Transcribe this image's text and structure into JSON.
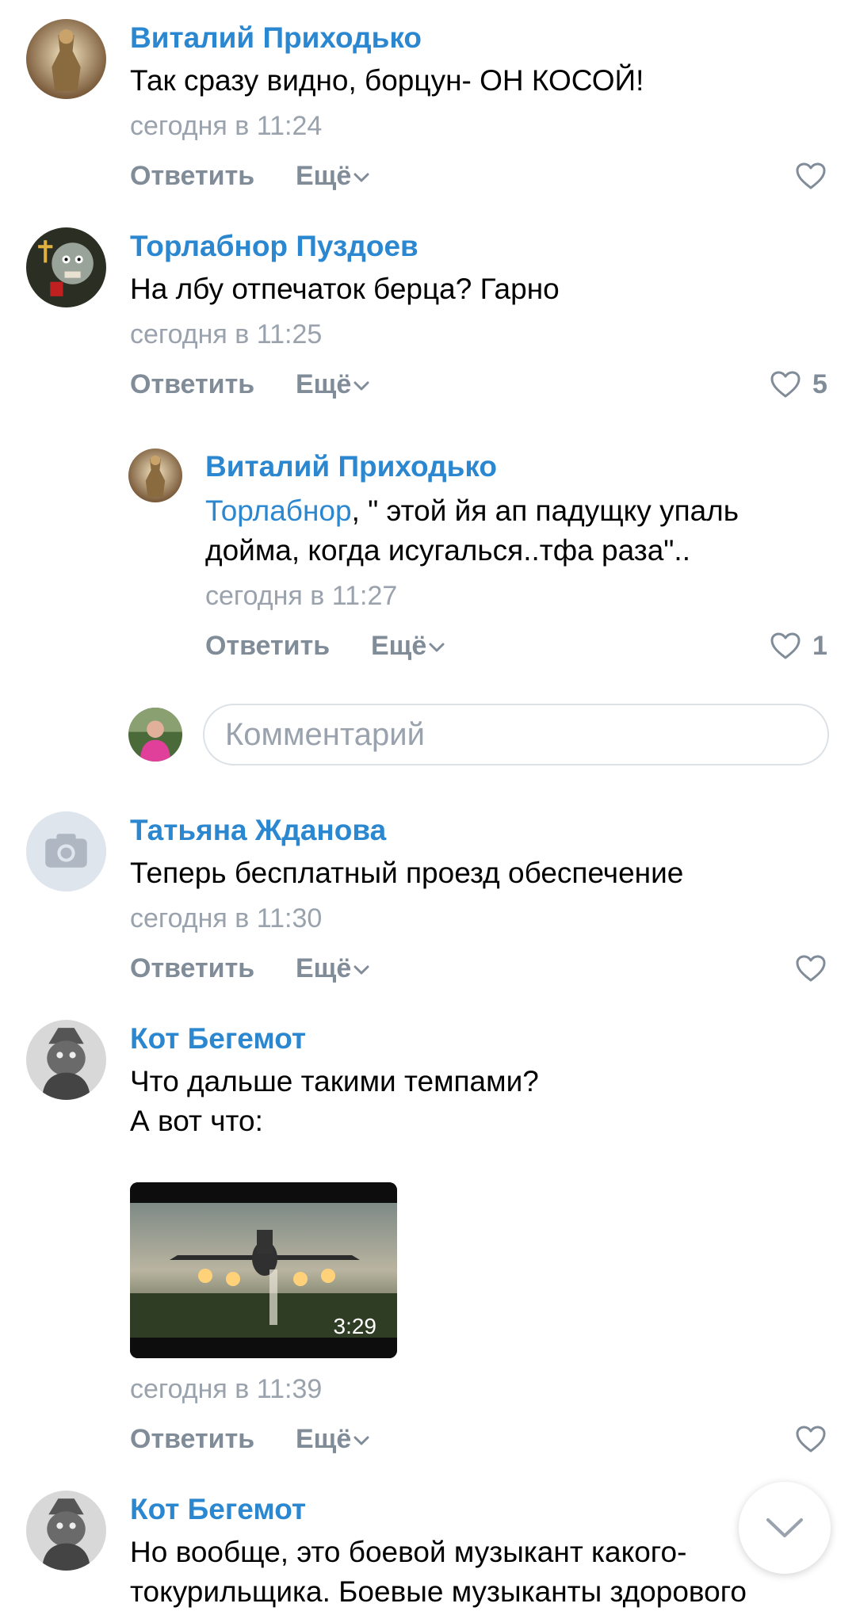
{
  "colors": {
    "author": "#2a87d0",
    "meta": "#99a2ad",
    "action": "#818c99",
    "like_icon": "#818c99"
  },
  "icons": {
    "like": "heart-outline-icon",
    "more": "chevron-down-icon",
    "scroll": "chevron-down-icon",
    "no_avatar": "camera-icon"
  },
  "comments": [
    {
      "author": "Виталий Приходько",
      "lines": [
        "Так сразу видно, борцун- ОН КОСОЙ!"
      ],
      "time": "сегодня в 11:24",
      "reply": "Ответить",
      "more": "Ещё",
      "likes": ""
    },
    {
      "author": "Торлабнор Пуздоев",
      "lines": [
        "На лбу отпечаток берца? Гарно"
      ],
      "time": "сегодня в 11:25",
      "reply": "Ответить",
      "more": "Ещё",
      "likes": "5"
    },
    {
      "author": "Виталий Приходько",
      "mention": "Торлабнор",
      "lines": [
        ", \" этой йя ап падущку упаль",
        "дойма, когда исугалься..тфа раза\".."
      ],
      "time": "сегодня в 11:27",
      "reply": "Ответить",
      "more": "Ещё",
      "likes": "1"
    },
    {
      "author": "Татьяна Жданова",
      "lines": [
        "Теперь бесплатный проезд обеспечение"
      ],
      "time": "сегодня в 11:30",
      "reply": "Ответить",
      "more": "Ещё",
      "likes": ""
    },
    {
      "author": "Кот Бегемот",
      "lines": [
        "Что дальше такими темпами?",
        "А вот что:"
      ],
      "video_duration": "3:29",
      "time": "сегодня в 11:39",
      "reply": "Ответить",
      "more": "Ещё",
      "likes": ""
    },
    {
      "author": "Кот Бегемот",
      "lines": [
        "Но вообще, это боевой музыкант какого-",
        "токурильщика. Боевые музыканты здорового"
      ]
    }
  ],
  "reply_input": {
    "placeholder": "Комментарий"
  }
}
